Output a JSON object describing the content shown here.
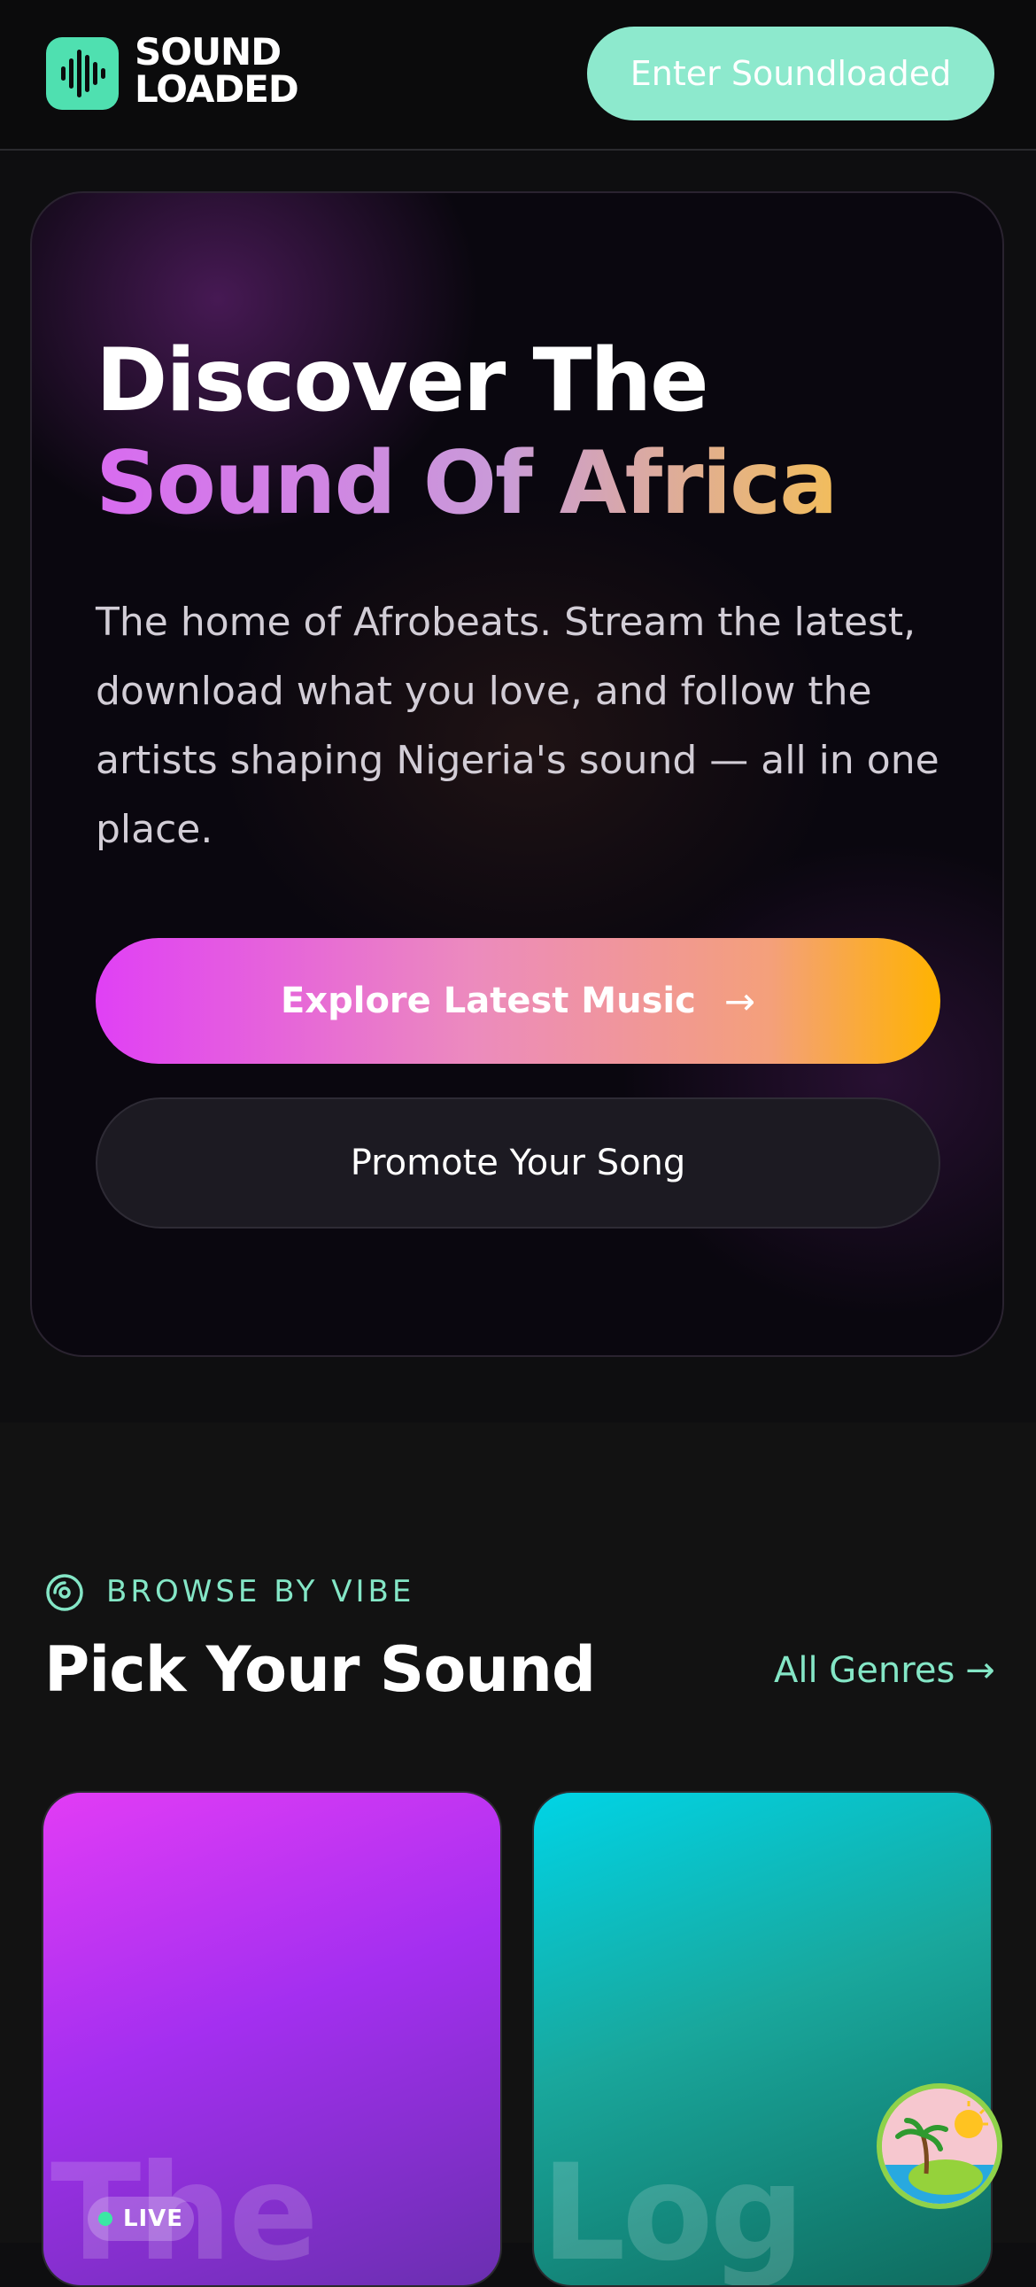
{
  "header": {
    "logo": {
      "icon": "sound-wave-icon",
      "line1": "SOUND",
      "line2": "LOADED",
      "accent": "#4fe0b0"
    },
    "enter_button": "Enter Soundloaded"
  },
  "hero": {
    "title_line1": "Discover The",
    "title_line2": "Sound Of Africa",
    "description": "The home of Afrobeats. Stream the latest, download what you love, and follow the artists shaping Nigeria's sound — all in one place.",
    "explore_button": "Explore Latest Music",
    "explore_arrow": "→",
    "promote_button": "Promote Your Song"
  },
  "browse": {
    "eyebrow_icon": "disc-icon",
    "eyebrow": "BROWSE BY VIBE",
    "title": "Pick Your Sound",
    "all_genres": "All Genres",
    "all_genres_arrow": "→",
    "cards": [
      {
        "ghost_text": "The",
        "badge": "LIVE"
      },
      {
        "ghost_text": "Log"
      }
    ]
  },
  "colors": {
    "mint": "#84e6c6",
    "magenta": "#e040f5",
    "amber": "#ffb300"
  },
  "fab": {
    "icon": "island-sun-icon"
  }
}
